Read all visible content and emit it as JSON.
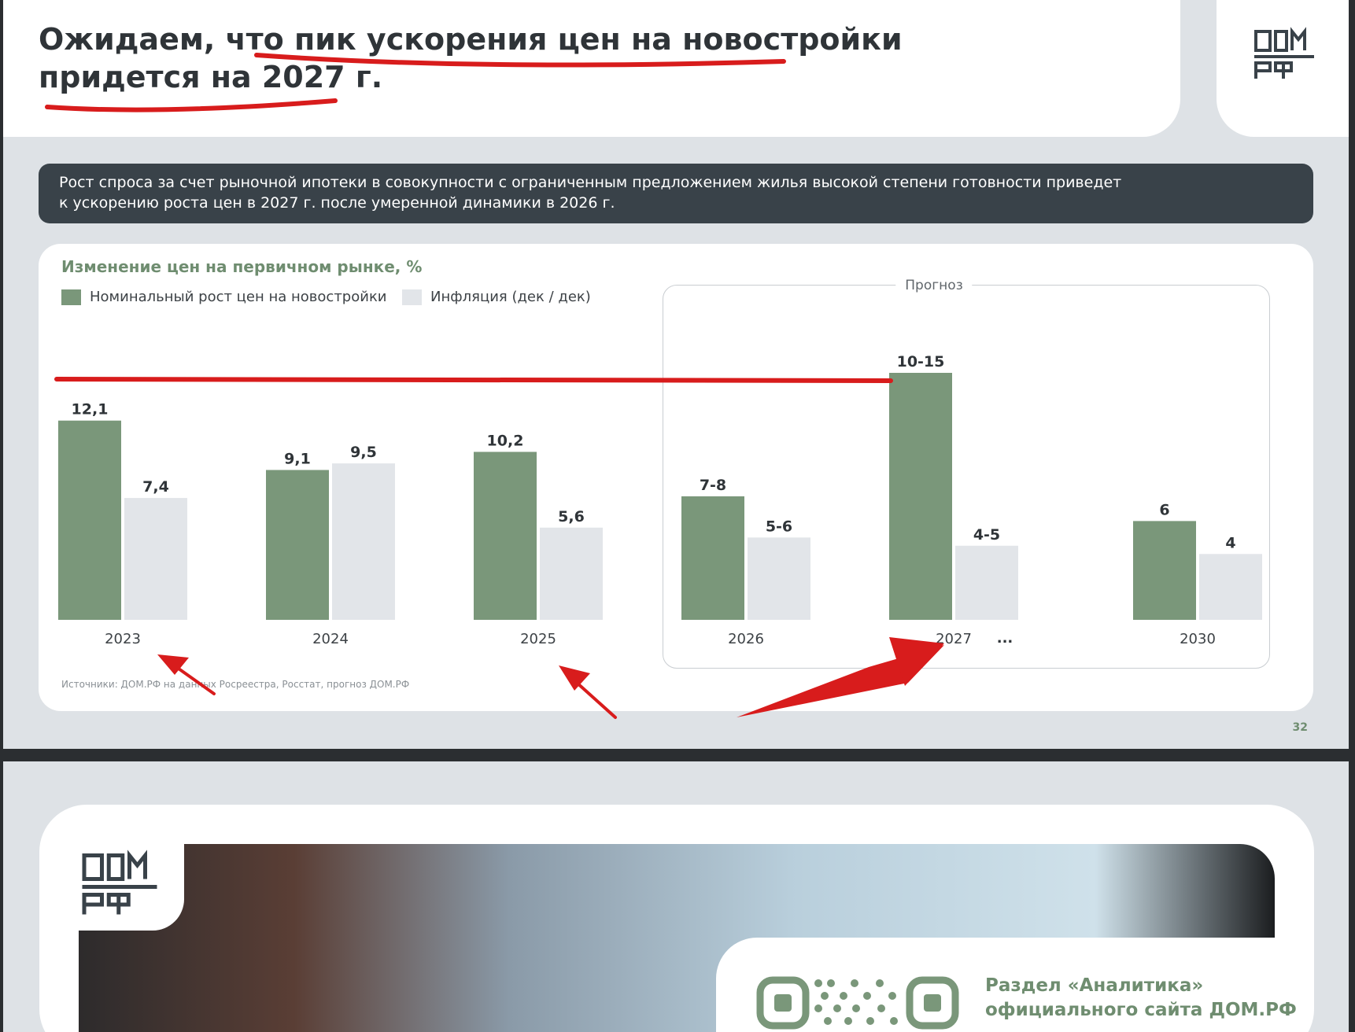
{
  "slide1": {
    "title": "Ожидаем, что пик ускорения цен на новостройки придется на 2027 г.",
    "summary_line1": "Рост спроса за счет рыночной ипотеки в совокупности с ограниченным предложением жилья высокой степени готовности приведет",
    "summary_line2": "к ускорению роста цен в 2027 г. после умеренной динамики в 2026 г.",
    "forecast_label": "Прогноз",
    "source": "Источники: ДОМ.РФ на данных Росреестра, Росстат, прогноз ДОМ.РФ",
    "page_number": "32",
    "gap_marker": "...",
    "colors": {
      "primary": "#7a977a",
      "inflation": "#e2e5e9",
      "accent": "#d81c1c",
      "dark": "#394249"
    }
  },
  "chart_data": {
    "type": "bar",
    "title": "Изменение цен на первичном рынке, %",
    "categories": [
      "2023",
      "2024",
      "2025",
      "2026",
      "2027",
      "2030"
    ],
    "series": [
      {
        "name": "Номинальный рост цен на новостройки",
        "values": [
          12.1,
          9.1,
          10.2,
          7.5,
          15,
          6
        ],
        "labels": [
          "12,1",
          "9,1",
          "10,2",
          "7-8",
          "10-15",
          "6"
        ],
        "color": "#7a977a"
      },
      {
        "name": "Инфляция (дек / дек)",
        "values": [
          7.4,
          9.5,
          5.6,
          5,
          4.5,
          4
        ],
        "labels": [
          "7,4",
          "9,5",
          "5,6",
          "5-6",
          "4-5",
          "4"
        ],
        "color": "#e2e5e9"
      }
    ],
    "forecast_categories": [
      "2026",
      "2027",
      "2030"
    ],
    "ylim": [
      0,
      15
    ],
    "grid": false,
    "legend": "top-left"
  },
  "slide2": {
    "analytics_line1": "Раздел «Аналитика»",
    "analytics_line2": "официального сайта ДОМ.РФ"
  }
}
